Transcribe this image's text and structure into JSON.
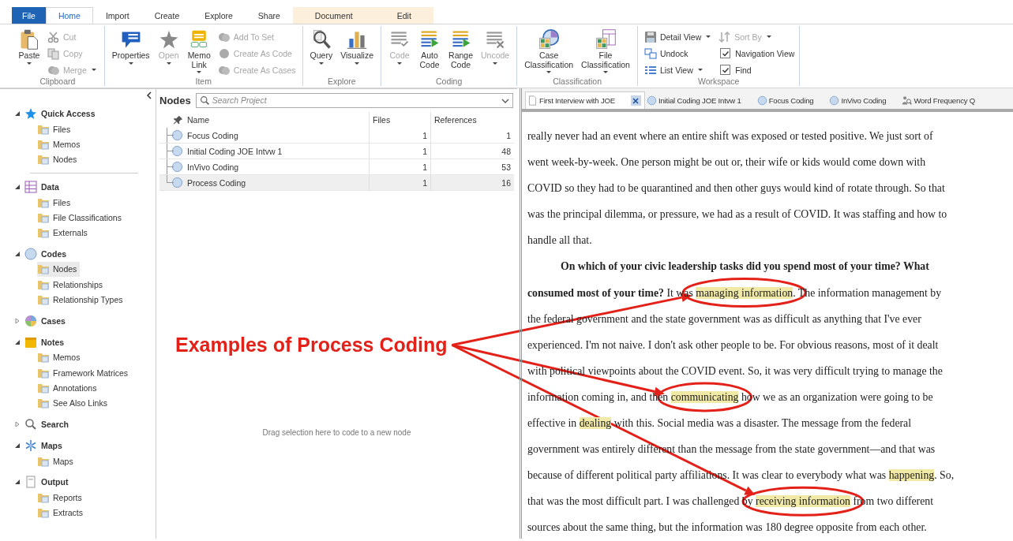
{
  "ribbon_tabs": [
    {
      "label": "File",
      "kind": "file",
      "selected": false
    },
    {
      "label": "Home",
      "kind": "main",
      "selected": true
    },
    {
      "label": "Import",
      "kind": "main",
      "selected": false
    },
    {
      "label": "Create",
      "kind": "main",
      "selected": false
    },
    {
      "label": "Explore",
      "kind": "main",
      "selected": false
    },
    {
      "label": "Share",
      "kind": "main",
      "selected": false
    },
    {
      "label": "Document",
      "kind": "contextual",
      "selected": false
    },
    {
      "label": "Edit",
      "kind": "contextual",
      "selected": false
    }
  ],
  "ribbon": [
    {
      "label": "Clipboard",
      "buttons": [
        {
          "kind": "large",
          "label": "Paste",
          "dropdown": true,
          "disabled": false
        },
        {
          "kind": "small",
          "label": "Cut",
          "dropdown": false,
          "disabled": true
        },
        {
          "kind": "small",
          "label": "Copy",
          "dropdown": false,
          "disabled": true
        },
        {
          "kind": "small",
          "label": "Merge",
          "dropdown": true,
          "disabled": true
        }
      ]
    },
    {
      "label": "Item",
      "buttons": [
        {
          "kind": "large",
          "label": "Properties",
          "dropdown": true,
          "disabled": false
        },
        {
          "kind": "large",
          "label": "Open",
          "dropdown": true,
          "disabled": true
        },
        {
          "kind": "large",
          "label": "Memo Link",
          "dropdown": true,
          "disabled": false
        },
        {
          "kind": "small",
          "label": "Add To Set",
          "dropdown": false,
          "disabled": true
        },
        {
          "kind": "small",
          "label": "Create As Code",
          "dropdown": false,
          "disabled": true
        },
        {
          "kind": "small",
          "label": "Create As Cases",
          "dropdown": false,
          "disabled": true
        }
      ]
    },
    {
      "label": "Explore",
      "buttons": [
        {
          "kind": "large",
          "label": "Query",
          "dropdown": true,
          "disabled": false
        },
        {
          "kind": "large",
          "label": "Visualize",
          "dropdown": true,
          "disabled": false
        }
      ]
    },
    {
      "label": "Coding",
      "buttons": [
        {
          "kind": "large",
          "label": "Code",
          "dropdown": true,
          "disabled": true
        },
        {
          "kind": "large",
          "label": "Auto Code",
          "dropdown": false,
          "disabled": false
        },
        {
          "kind": "large",
          "label": "Range Code",
          "dropdown": false,
          "disabled": false
        },
        {
          "kind": "large",
          "label": "Uncode",
          "dropdown": true,
          "disabled": true
        }
      ]
    },
    {
      "label": "Classification",
      "buttons": [
        {
          "kind": "large",
          "label": "Case Classification",
          "dropdown": true,
          "disabled": false
        },
        {
          "kind": "large",
          "label": "File Classification",
          "dropdown": true,
          "disabled": false
        }
      ]
    },
    {
      "label": "Workspace",
      "buttons": [
        {
          "kind": "small",
          "label": "Detail View",
          "dropdown": true,
          "disabled": false
        },
        {
          "kind": "small",
          "label": "Undock",
          "dropdown": false,
          "disabled": false
        },
        {
          "kind": "small",
          "label": "List View",
          "dropdown": true,
          "disabled": false
        },
        {
          "kind": "small",
          "label": "Sort By",
          "dropdown": true,
          "disabled": true
        },
        {
          "kind": "check",
          "label": "Navigation View",
          "checked": true
        },
        {
          "kind": "check",
          "label": "Find",
          "checked": true
        }
      ]
    }
  ],
  "navigation": [
    {
      "label": "Quick Access",
      "expanded": true,
      "children": [
        {
          "label": "Files",
          "selected": false
        },
        {
          "label": "Memos",
          "selected": false
        },
        {
          "label": "Nodes",
          "selected": false
        }
      ]
    },
    {
      "label": "Data",
      "expanded": true,
      "children": [
        {
          "label": "Files",
          "selected": false
        },
        {
          "label": "File Classifications",
          "selected": false
        },
        {
          "label": "Externals",
          "selected": false
        }
      ]
    },
    {
      "label": "Codes",
      "expanded": true,
      "children": [
        {
          "label": "Nodes",
          "selected": true
        },
        {
          "label": "Relationships",
          "selected": false
        },
        {
          "label": "Relationship Types",
          "selected": false
        }
      ]
    },
    {
      "label": "Cases",
      "expanded": false
    },
    {
      "label": "Notes",
      "expanded": true,
      "children": [
        {
          "label": "Memos",
          "selected": false
        },
        {
          "label": "Framework Matrices",
          "selected": false
        },
        {
          "label": "Annotations",
          "selected": false
        },
        {
          "label": "See Also Links",
          "selected": false
        }
      ]
    },
    {
      "label": "Search",
      "expanded": false
    },
    {
      "label": "Maps",
      "expanded": true,
      "children": [
        {
          "label": "Maps",
          "selected": false
        }
      ]
    },
    {
      "label": "Output",
      "expanded": true,
      "children": [
        {
          "label": "Reports",
          "selected": false
        },
        {
          "label": "Extracts",
          "selected": false
        }
      ]
    }
  ],
  "nodes_panel": {
    "title": "Nodes",
    "search": {
      "placeholder": "Search Project"
    },
    "columns": [
      "Name",
      "Files",
      "References"
    ],
    "rows": [
      {
        "name": "Focus Coding",
        "files": "1",
        "references": "1",
        "selected": false
      },
      {
        "name": "Initial Coding JOE Intvw 1",
        "files": "1",
        "references": "48",
        "selected": false
      },
      {
        "name": "InVivo Coding",
        "files": "1",
        "references": "53",
        "selected": false
      },
      {
        "name": "Process Coding",
        "files": "1",
        "references": "16",
        "selected": true
      }
    ],
    "drop_hint": "Drag selection here to code to a new node"
  },
  "document": {
    "tabs": [
      {
        "label": "First Interview with JOE",
        "kind": "document",
        "selected": true
      },
      {
        "label": "Initial Coding JOE Intvw 1",
        "kind": "node",
        "selected": false
      },
      {
        "label": "Focus Coding",
        "kind": "node",
        "selected": false
      },
      {
        "label": "InVivo Coding",
        "kind": "node",
        "selected": false
      },
      {
        "label": "Word Frequency Q",
        "kind": "query",
        "selected": false
      }
    ],
    "lines": [
      {
        "indented": false,
        "segments": [
          {
            "kind": "plain",
            "text": "really never had an event where an entire shift was exposed or tested positive. We just sort of"
          }
        ]
      },
      {
        "indented": false,
        "segments": [
          {
            "kind": "plain",
            "text": "went week-by-week. One person might be out or, their wife or kids would come down with"
          }
        ]
      },
      {
        "indented": false,
        "segments": [
          {
            "kind": "plain",
            "text": "COVID so they had to be quarantined and then other guys would kind of rotate through. So that"
          }
        ]
      },
      {
        "indented": false,
        "segments": [
          {
            "kind": "plain",
            "text": "was the principal dilemma, or pressure, we had as a result of COVID. It was staffing and how to"
          }
        ]
      },
      {
        "indented": false,
        "segments": [
          {
            "kind": "plain",
            "text": "handle all that."
          }
        ]
      },
      {
        "indented": true,
        "segments": [
          {
            "kind": "bold",
            "text": "On which of your civic leadership tasks did you spend most of your time? What"
          }
        ]
      },
      {
        "indented": false,
        "segments": [
          {
            "kind": "bold",
            "text": "consumed most of your time?"
          },
          {
            "kind": "plain",
            "text": " It was "
          },
          {
            "kind": "circled",
            "text": "managing information"
          },
          {
            "kind": "plain",
            "text": ". The information management by"
          }
        ]
      },
      {
        "indented": false,
        "segments": [
          {
            "kind": "plain",
            "text": "the federal government and the state government was as difficult as anything that I've ever"
          }
        ]
      },
      {
        "indented": false,
        "segments": [
          {
            "kind": "plain",
            "text": "experienced. I'm not naive. I don't ask other people to be. For obvious reasons, most of it dealt"
          }
        ]
      },
      {
        "indented": false,
        "segments": [
          {
            "kind": "plain",
            "text": "with political viewpoints about the COVID event. So, it was very difficult trying to manage the"
          }
        ]
      },
      {
        "indented": false,
        "segments": [
          {
            "kind": "plain",
            "text": "information coming in, and then "
          },
          {
            "kind": "circled",
            "text": "communicating"
          },
          {
            "kind": "plain",
            "text": " how we as an organization were going to be"
          }
        ]
      },
      {
        "indented": false,
        "segments": [
          {
            "kind": "plain",
            "text": "effective in "
          },
          {
            "kind": "highlight",
            "text": "dealing"
          },
          {
            "kind": "plain",
            "text": " with this. Social media was a disaster. The message from the federal"
          }
        ]
      },
      {
        "indented": false,
        "segments": [
          {
            "kind": "plain",
            "text": "government was entirely different than the message from the state government—and that was"
          }
        ]
      },
      {
        "indented": false,
        "segments": [
          {
            "kind": "plain",
            "text": "because of different political party affiliations. It was clear to everybody what was "
          },
          {
            "kind": "highlight",
            "text": "happening"
          },
          {
            "kind": "plain",
            "text": ". So,"
          }
        ]
      },
      {
        "indented": false,
        "segments": [
          {
            "kind": "plain",
            "text": "that was the most difficult part. I was challenged by "
          },
          {
            "kind": "circled",
            "text": "receiving information"
          },
          {
            "kind": "plain",
            "text": " from two different"
          }
        ]
      },
      {
        "indented": false,
        "segments": [
          {
            "kind": "plain",
            "text": "sources about the same thing, but the information was 180 degree opposite from each other."
          }
        ]
      }
    ]
  },
  "annotation": {
    "label": "Examples of Process Coding"
  }
}
